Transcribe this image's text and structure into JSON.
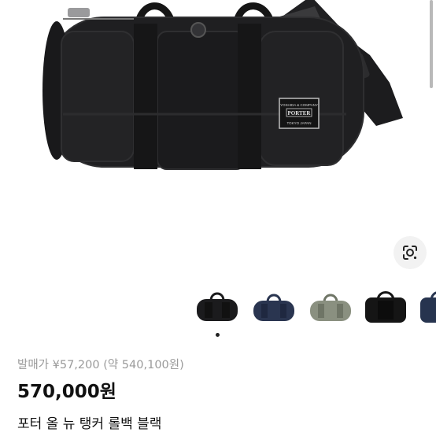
{
  "product": {
    "brand_tag_top": "YOSHIDA & COMPANY",
    "brand_name": "PORTER",
    "brand_tag_bottom": "TOKYO JAPAN",
    "release_price": "발매가 ¥57,200 (약 540,100원)",
    "price": "570,000원",
    "title": "포터 올 뉴 탱커 롤백 블랙"
  },
  "thumbnails": [
    {
      "name": "thumb-black",
      "color": "#1b1b1d"
    },
    {
      "name": "thumb-navy",
      "color": "#2a3550"
    },
    {
      "name": "thumb-sage",
      "color": "#8a9080"
    },
    {
      "name": "thumb-black-2",
      "color": "#151515"
    },
    {
      "name": "thumb-navy-2",
      "color": "#27344f"
    }
  ],
  "colors": {
    "accent": "#111111",
    "muted": "#9a9a9a",
    "bag": "#1e1e20"
  },
  "gallery": {
    "image_count": 1,
    "current_index": 1
  }
}
